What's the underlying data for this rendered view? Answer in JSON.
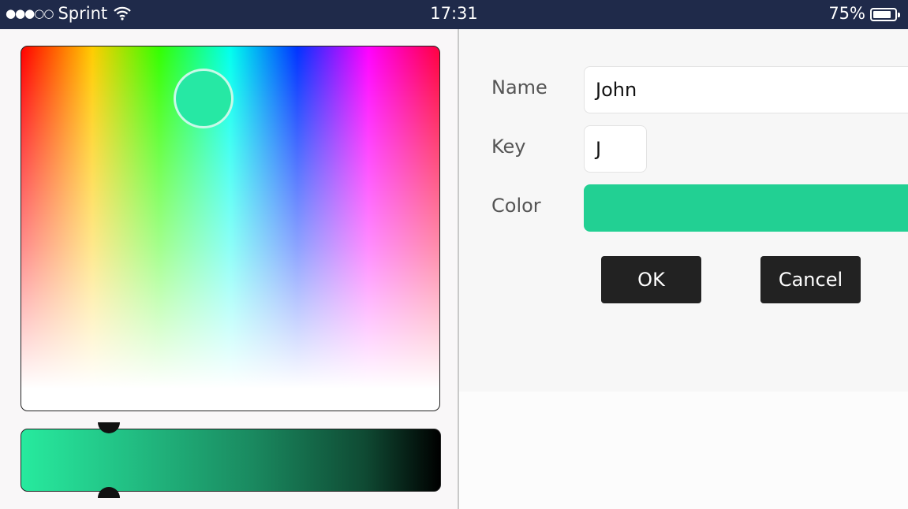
{
  "status_bar": {
    "signal": "●●●○○",
    "carrier": "Sprint",
    "time": "17:31",
    "battery": "75%"
  },
  "color_picker": {
    "selected_color": "#22d093",
    "brightness_level_percent": 21
  },
  "form": {
    "name_label": "Name",
    "name_value": "John",
    "key_label": "Key",
    "key_value": "J",
    "color_label": "Color",
    "color_value": "#22d093"
  },
  "buttons": {
    "ok_label": "OK",
    "cancel_label": "Cancel"
  },
  "colors": {
    "status_bar_bg": "#1f2a4a",
    "button_bg": "#222222"
  },
  "icons": [
    "wifi-icon",
    "battery-icon"
  ]
}
